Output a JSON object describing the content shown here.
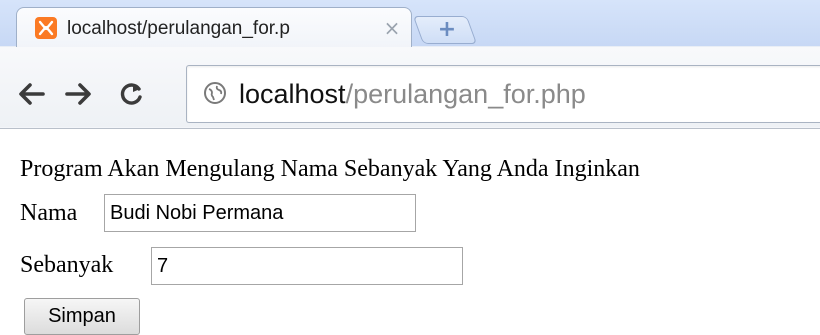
{
  "browser": {
    "tab_title": "localhost/perulangan_for.p",
    "tab_close_glyph": "×",
    "new_tab_glyph": "+",
    "url_host": "localhost",
    "url_path": "/perulangan_for.php",
    "icons": {
      "favicon": "xampp-logo-icon",
      "back": "back-arrow-icon",
      "forward": "forward-arrow-icon",
      "reload": "reload-icon",
      "site": "globe-icon"
    },
    "colors": {
      "favicon_bg": "#fb7a24",
      "url_path_color": "#8a8a8a"
    }
  },
  "page": {
    "heading": "Program Akan Mengulang Nama Sebanyak Yang Anda Inginkan",
    "nama_label": "Nama",
    "nama_value": "Budi Nobi Permana",
    "sebanyak_label": "Sebanyak",
    "sebanyak_value": "7",
    "submit_label": "Simpan"
  }
}
